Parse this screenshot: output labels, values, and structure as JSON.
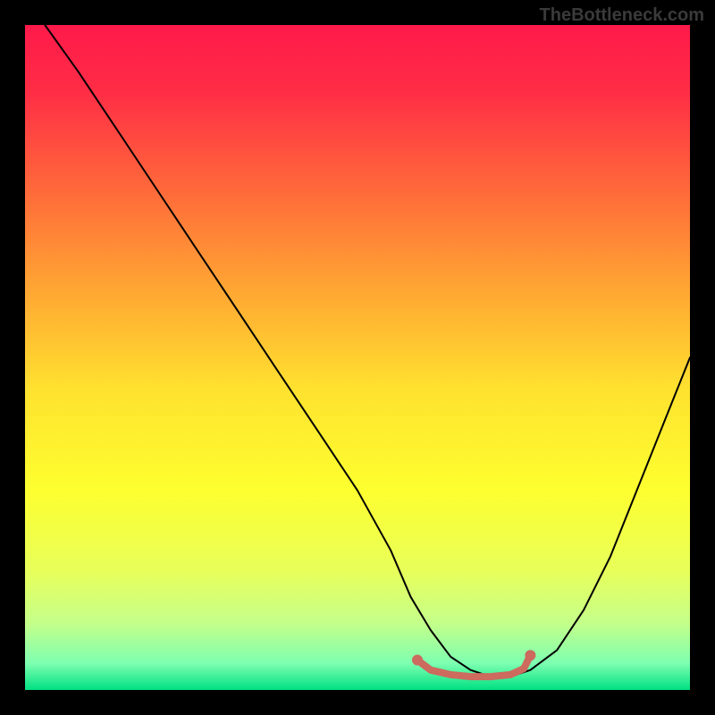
{
  "watermark": "TheBottleneck.com",
  "chart_data": {
    "type": "line",
    "title": "",
    "xlabel": "",
    "ylabel": "",
    "xlim": [
      0,
      100
    ],
    "ylim": [
      0,
      100
    ],
    "background_gradient": {
      "stops": [
        {
          "offset": 0.0,
          "color": "#ff1a4a"
        },
        {
          "offset": 0.1,
          "color": "#ff2d46"
        },
        {
          "offset": 0.25,
          "color": "#ff6a3a"
        },
        {
          "offset": 0.4,
          "color": "#ffa733"
        },
        {
          "offset": 0.55,
          "color": "#ffe22f"
        },
        {
          "offset": 0.7,
          "color": "#fdff2f"
        },
        {
          "offset": 0.82,
          "color": "#e8ff5a"
        },
        {
          "offset": 0.9,
          "color": "#c4ff8a"
        },
        {
          "offset": 0.96,
          "color": "#7dffb0"
        },
        {
          "offset": 1.0,
          "color": "#00e083"
        }
      ]
    },
    "series": [
      {
        "name": "bottleneck-curve",
        "color": "#000000",
        "stroke_width": 2,
        "x": [
          3,
          8,
          14,
          20,
          26,
          32,
          38,
          44,
          50,
          55,
          58,
          61,
          64,
          67,
          70,
          73,
          76,
          80,
          84,
          88,
          92,
          96,
          100
        ],
        "y": [
          100,
          93,
          84,
          75,
          66,
          57,
          48,
          39,
          30,
          21,
          14,
          9,
          5,
          3,
          2,
          2,
          3,
          6,
          12,
          20,
          30,
          40,
          50
        ]
      },
      {
        "name": "optimal-range-marker",
        "color": "#cc6b5e",
        "stroke_width": 8,
        "x": [
          59,
          61,
          64,
          67,
          70,
          73,
          75,
          76
        ],
        "y": [
          4.5,
          3.0,
          2.3,
          2.0,
          2.0,
          2.3,
          3.2,
          5.2
        ]
      }
    ],
    "markers": [
      {
        "name": "optimal-start-dot",
        "x": 59,
        "y": 4.5,
        "color": "#cc6b5e",
        "size": 6
      },
      {
        "name": "optimal-end-dot",
        "x": 76,
        "y": 5.2,
        "color": "#cc6b5e",
        "size": 6
      }
    ]
  }
}
